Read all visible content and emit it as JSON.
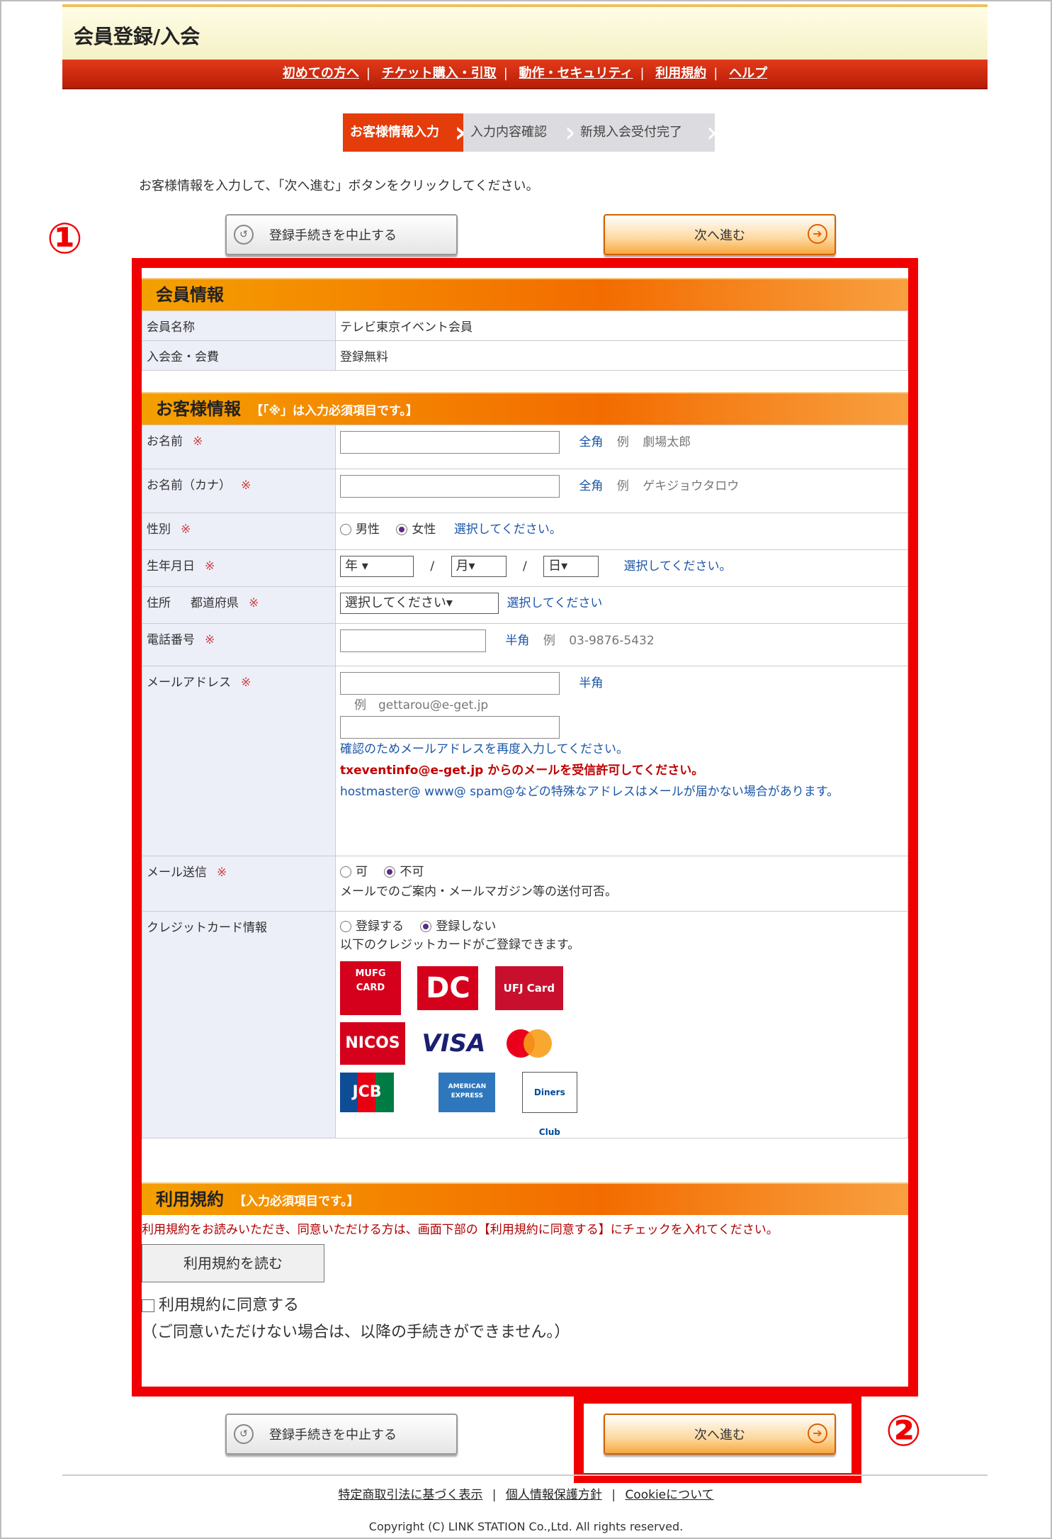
{
  "header": {
    "title": "会員登録/入会"
  },
  "nav": {
    "items": [
      "初めての方へ",
      "チケット購入・引取",
      "動作・セキュリティ",
      "利用規約",
      "ヘルプ"
    ],
    "separator": "|"
  },
  "steps": [
    "お客様情報入力",
    "入力内容確認",
    "新規入会受付完了"
  ],
  "instruction": "お客様情報を入力して、「次へ進む」ボタンをクリックしてください。",
  "buttons": {
    "cancel": "登録手続きを中止する",
    "next": "次へ進む",
    "cancel_icon": "↺",
    "next_icon": "➔"
  },
  "annotations": {
    "one": "①",
    "two": "②"
  },
  "member": {
    "title": "会員情報",
    "rows": [
      {
        "label": "会員名称",
        "value": "テレビ東京イベント会員"
      },
      {
        "label": "入会金・会費",
        "value": "登録無料"
      }
    ]
  },
  "customer": {
    "title": "お客様情報",
    "note": "【「※」は入力必須項目です。】",
    "req_mark": "※",
    "name": {
      "label": "お名前",
      "hint": "全角",
      "example_prefix": "例",
      "example": "劇場太郎"
    },
    "kana": {
      "label": "お名前（カナ）",
      "hint": "全角",
      "example_prefix": "例",
      "example": "ゲキジョウタロウ"
    },
    "gender": {
      "label": "性別",
      "options": [
        "男性",
        "女性"
      ],
      "selected": 1,
      "prompt": "選択してください。"
    },
    "birth": {
      "label": "生年月日",
      "year": "年",
      "month": "月",
      "day": "日",
      "sep": "/",
      "prompt": "選択してください。"
    },
    "address": {
      "label": "住所",
      "sub": "都道府県",
      "select": "選択してください",
      "prompt": "選択してください"
    },
    "phone": {
      "label": "電話番号",
      "hint": "半角",
      "example_prefix": "例",
      "example": "03-9876-5432"
    },
    "email": {
      "label": "メールアドレス",
      "hint": "半角",
      "example": "例　gettarou@e-get.jp",
      "confirm_note": "確認のためメールアドレスを再度入力してください。",
      "warning": "txeventinfo@e-get.jp からのメールを受信許可してください。",
      "special": "hostmaster@ www@ spam@などの特殊なアドレスはメールが届かない場合があります。"
    },
    "mail_send": {
      "label": "メール送信",
      "options": [
        "可",
        "不可"
      ],
      "selected": 1,
      "note": "メールでのご案内・メールマガジン等の送付可否。"
    },
    "credit": {
      "label": "クレジットカード情報",
      "options": [
        "登録する",
        "登録しない"
      ],
      "selected": 1,
      "note": "以下のクレジットカードがご登録できます。",
      "cards": [
        "MUFG CARD",
        "DC",
        "UFJ Card",
        "NICOS",
        "VISA",
        "mastercard",
        "JCB",
        "AMERICAN EXPRESS",
        "Diners Club"
      ]
    }
  },
  "rules": {
    "title": "利用規約",
    "note": "【入力必須項目です。】",
    "text": "利用規約をお読みいただき、同意いただける方は、画面下部の【利用規約に同意する】にチェックを入れてください。",
    "read_button": "利用規約を読む",
    "agree": "利用規約に同意する",
    "agree_note": "（ご同意いただけない場合は、以降の手続きができません。）"
  },
  "footer": {
    "links": [
      "特定商取引法に基づく表示",
      "個人情報保護方針",
      "Cookieについて"
    ],
    "separator": "|",
    "copyright": "Copyright (C) LINK STATION Co.,Ltd. All rights reserved."
  }
}
